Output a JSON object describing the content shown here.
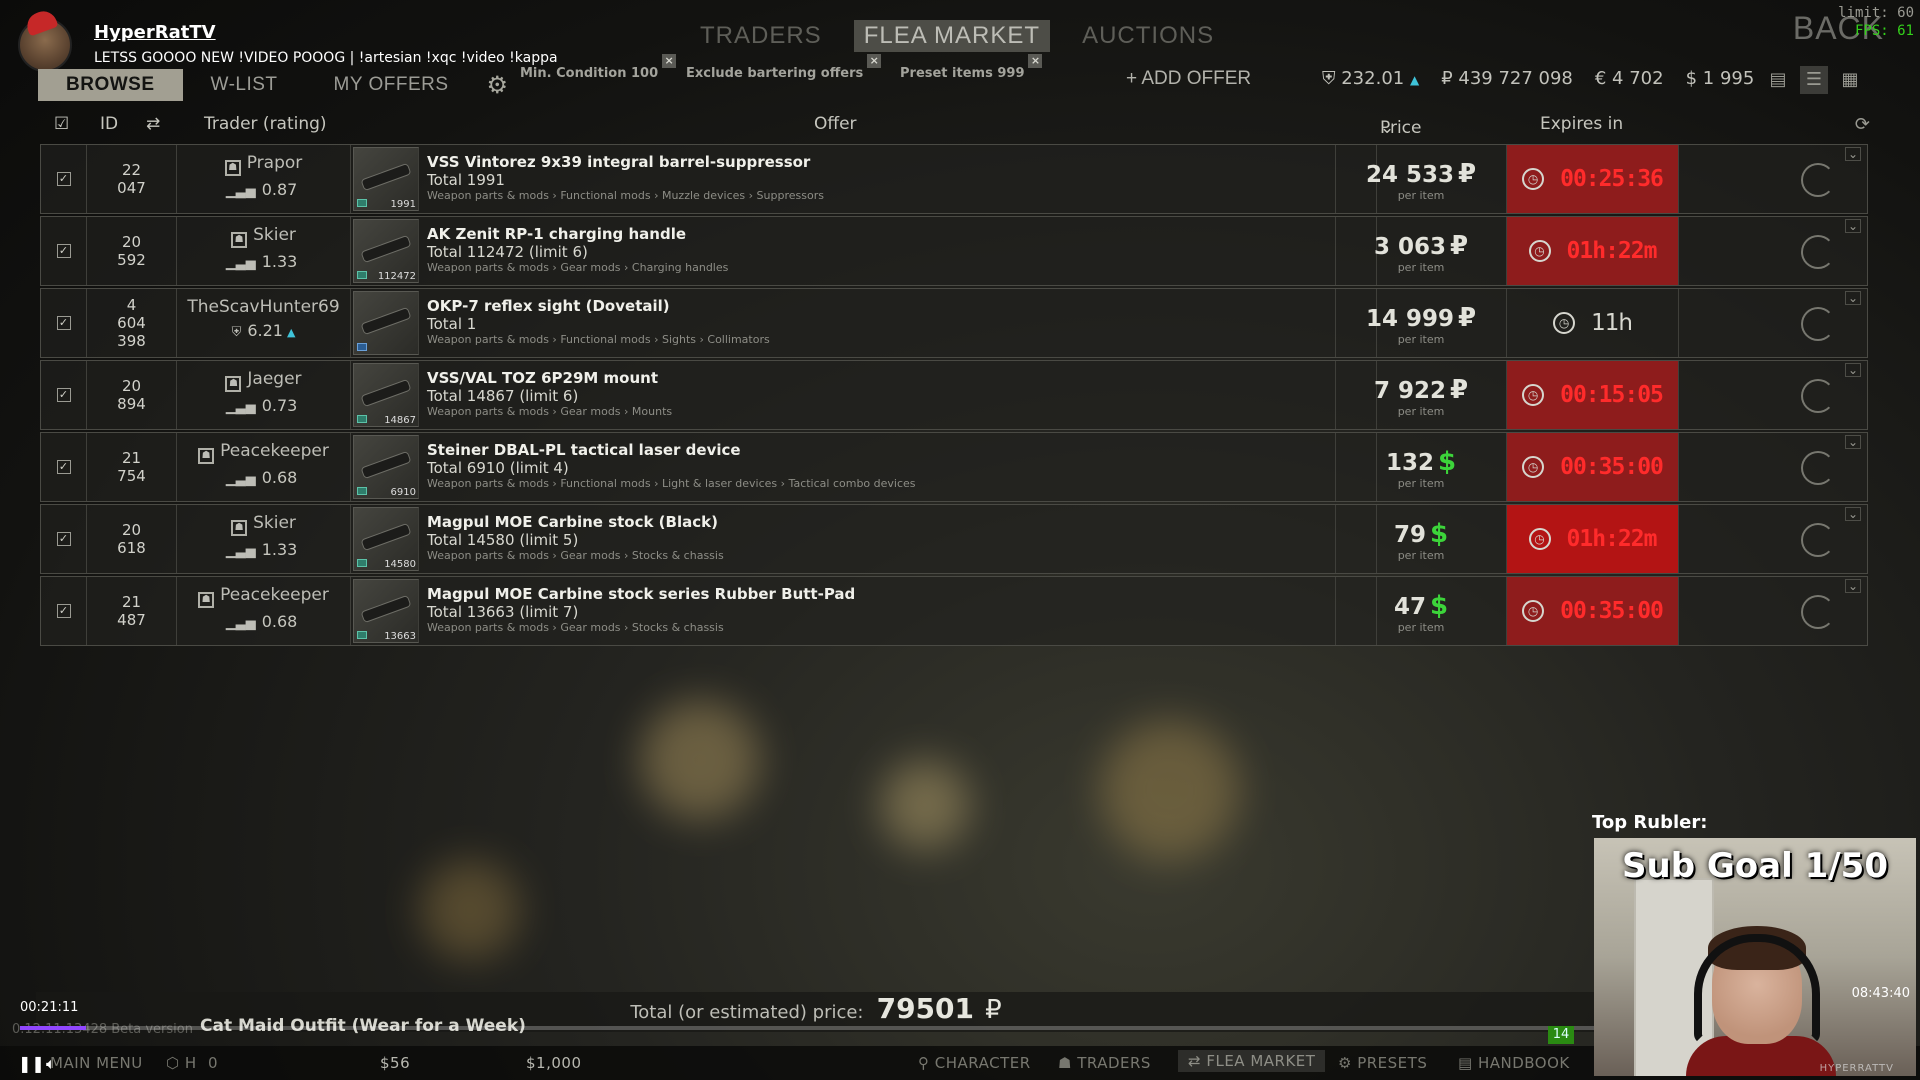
{
  "stream": {
    "channel": "HyperRatTV",
    "status": "LETSS GOOOO NEW !VIDEO POOOG | !artesian !xqc !video !kappa",
    "limit": "limit: 60",
    "fps": "FPS: 61",
    "back": "BACK"
  },
  "top_tabs": [
    "TRADERS",
    "FLEA MARKET",
    "AUCTIONS"
  ],
  "sub_tabs": [
    "BROWSE",
    "W-LIST",
    "MY OFFERS"
  ],
  "filters": [
    "Min. Condition 100",
    "Exclude bartering offers",
    "Preset items 999"
  ],
  "add_offer": "+ ADD OFFER",
  "balances": {
    "rating": "232.01",
    "rub": "₽ 439 727 098",
    "eur": "€ 4 702",
    "usd": "$ 1 995"
  },
  "table_header": {
    "id": "ID",
    "trader": "Trader (rating)",
    "offer": "Offer",
    "price": "Price",
    "expires": "Expires in"
  },
  "rows": [
    {
      "id1": "22",
      "id2": "047",
      "id3": "",
      "trader": "Prapor",
      "rating": "0.87",
      "rating_type": "trader",
      "qty": "1991",
      "name": "VSS Vintorez 9x39 integral barrel-suppressor",
      "total": "Total 1991",
      "limit": "",
      "category": "Weapon parts & mods › Functional mods › Muzzle devices › Suppressors",
      "price": "24 533",
      "currency": "₽",
      "expires": "00:25:36",
      "expires_style": "red"
    },
    {
      "id1": "20",
      "id2": "592",
      "id3": "",
      "trader": "Skier",
      "rating": "1.33",
      "rating_type": "trader",
      "qty": "112472",
      "name": "AK Zenit RP-1 charging handle",
      "total": "Total 112472",
      "limit": "(limit 6)",
      "category": "Weapon parts & mods › Gear mods › Charging handles",
      "price": "3 063",
      "currency": "₽",
      "expires": "01h:22m",
      "expires_style": "red"
    },
    {
      "id1": "4",
      "id2": "604",
      "id3": "398",
      "trader": "TheScavHunter69",
      "rating": "6.21",
      "rating_type": "player",
      "qty": "",
      "name": "OKP-7 reflex sight (Dovetail)",
      "total": "Total 1",
      "limit": "",
      "category": "Weapon parts & mods › Functional mods › Sights › Collimators",
      "price": "14 999",
      "currency": "₽",
      "expires": "11h",
      "expires_style": "normal"
    },
    {
      "id1": "20",
      "id2": "894",
      "id3": "",
      "trader": "Jaeger",
      "rating": "0.73",
      "rating_type": "trader",
      "qty": "14867",
      "name": "VSS/VAL TOZ 6P29M mount",
      "total": "Total 14867",
      "limit": "(limit 6)",
      "category": "Weapon parts & mods › Gear mods › Mounts",
      "price": "7 922",
      "currency": "₽",
      "expires": "00:15:05",
      "expires_style": "red"
    },
    {
      "id1": "21",
      "id2": "754",
      "id3": "",
      "trader": "Peacekeeper",
      "rating": "0.68",
      "rating_type": "trader",
      "qty": "6910",
      "name": "Steiner DBAL-PL tactical laser device",
      "total": "Total 6910",
      "limit": "(limit 4)",
      "category": "Weapon parts & mods › Functional mods › Light & laser devices › Tactical combo devices",
      "price": "132",
      "currency": "$",
      "expires": "00:35:00",
      "expires_style": "red"
    },
    {
      "id1": "20",
      "id2": "618",
      "id3": "",
      "trader": "Skier",
      "rating": "1.33",
      "rating_type": "trader",
      "qty": "14580",
      "name": "Magpul MOE Carbine stock (Black)",
      "total": "Total 14580",
      "limit": "(limit 5)",
      "category": "Weapon parts & mods › Gear mods › Stocks & chassis",
      "price": "79",
      "currency": "$",
      "expires": "01h:22m",
      "expires_style": "red bright"
    },
    {
      "id1": "21",
      "id2": "487",
      "id3": "",
      "trader": "Peacekeeper",
      "rating": "0.68",
      "rating_type": "trader",
      "qty": "13663",
      "name": "Magpul MOE Carbine stock series Rubber Butt-Pad",
      "total": "Total 13663",
      "limit": "(limit 7)",
      "category": "Weapon parts & mods › Gear mods › Stocks & chassis",
      "price": "47",
      "currency": "$",
      "expires": "00:35:00",
      "expires_style": "red"
    }
  ],
  "per_item": "per item",
  "total_label": "Total (or estimated) price:",
  "total_value": "79501",
  "total_currency": "₽",
  "player": {
    "elapsed": "00:21:11",
    "duration": "08:43:40",
    "progress": 0.035,
    "overlay": "Cat Maid Outfit (Wear for a Week)",
    "beta": "0.12.11.13428 Beta version",
    "badge": "14"
  },
  "taskbar": {
    "main_menu": "MAIN MENU",
    "hideout_short": "H",
    "zero": "0",
    "money1": "$56",
    "money2": "$1,000",
    "character": "CHARACTER",
    "traders": "TRADERS",
    "flea": "FLEA MARKET",
    "presets": "PRESETS",
    "handbook": "HANDBOOK"
  },
  "cam": {
    "label": "Top Rubler:",
    "goal": "Sub Goal 1/50",
    "watermark": "HYPERRATTV"
  },
  "colors": {
    "expire_red": "#8e1c1c",
    "usd_green": "#3cd43a",
    "accent_cyan": "#3fc3d9",
    "fps_green": "#34d11b"
  }
}
